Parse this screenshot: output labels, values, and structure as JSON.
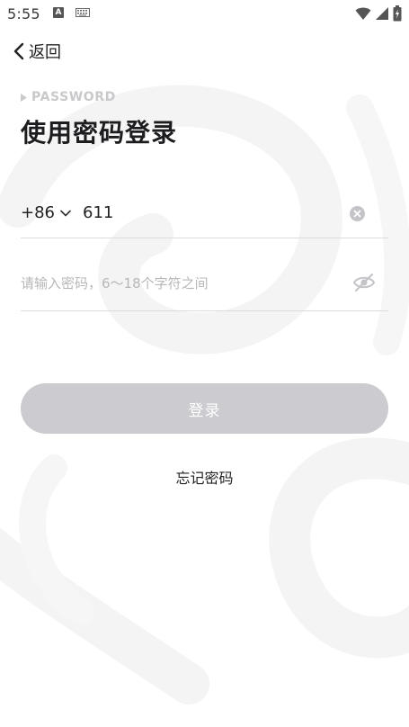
{
  "status_bar": {
    "time": "5:55",
    "icons": [
      "keyboard-a-icon",
      "keyboard-icon",
      "wifi-icon",
      "signal-icon",
      "battery-icon"
    ]
  },
  "nav": {
    "back_label": "返回"
  },
  "header": {
    "kicker": "PASSWORD",
    "title": "使用密码登录"
  },
  "form": {
    "country_code": "+86",
    "phone_value": "611",
    "password_placeholder": "请输入密码，6～18个字符之间",
    "password_value": ""
  },
  "actions": {
    "login_label": "登录",
    "forgot_label": "忘记密码"
  },
  "colors": {
    "accent_disabled": "#cbcbd0",
    "text": "#1d1d1f",
    "placeholder": "#b7b7ba",
    "background_art": "#f5f5f6"
  }
}
